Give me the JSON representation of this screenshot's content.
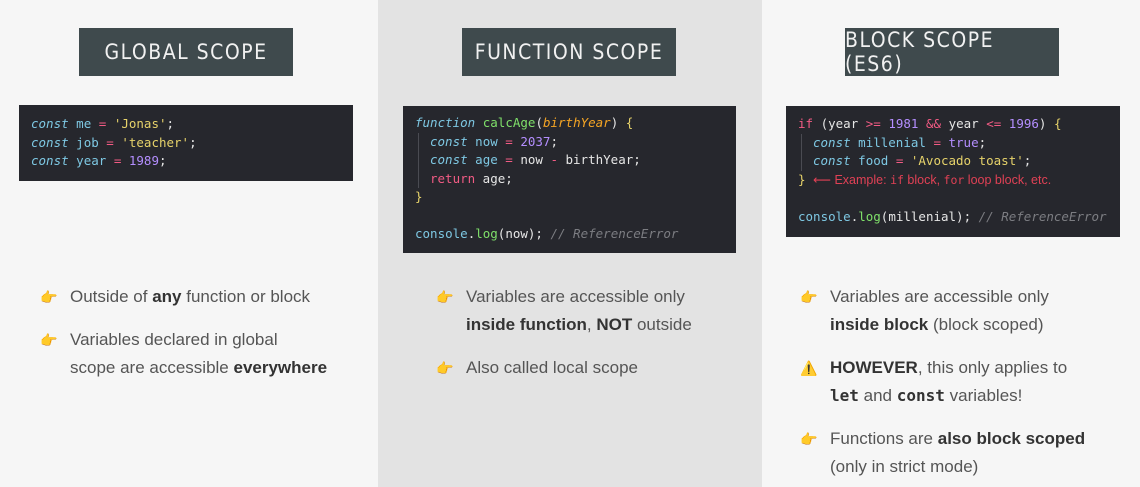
{
  "global": {
    "title": "GLOBAL SCOPE",
    "bullet1": {
      "pre": "Outside of ",
      "bold": "any",
      "post": " function or block"
    },
    "bullet2": {
      "line1": "Variables declared in global",
      "line2_pre": "scope are accessible ",
      "line2_bold": "everywhere"
    }
  },
  "function": {
    "title": "FUNCTION SCOPE",
    "bullet1": {
      "line1": "Variables are accessible only",
      "bold1": "inside function",
      "mid": ", ",
      "bold2": "NOT",
      "post": " outside"
    },
    "bullet2": {
      "text": "Also called local scope"
    }
  },
  "block": {
    "title": "BLOCK SCOPE (ES6)",
    "annotation": {
      "pre": "Example: ",
      "if": "if",
      "mid1": " block, ",
      "for": "for",
      "post": " loop block, etc."
    },
    "bullet1": {
      "line1": "Variables are accessible only",
      "bold": "inside block",
      "post": " (block scoped)"
    },
    "bullet2": {
      "bold": "HOWEVER",
      "line1_post": ", this only applies to",
      "let": "let",
      "and": " and ",
      "const": "const",
      "post": " variables!"
    },
    "bullet3": {
      "pre": "Functions are ",
      "bold": "also block scoped",
      "line2": "(only in strict mode)"
    }
  },
  "icons": {
    "pointer": "pointing-hand-icon",
    "warning": "warning-icon"
  },
  "colors": {
    "title_bg": "#3f4a4d",
    "code_bg": "#26272d",
    "annotation": "#e04155"
  }
}
